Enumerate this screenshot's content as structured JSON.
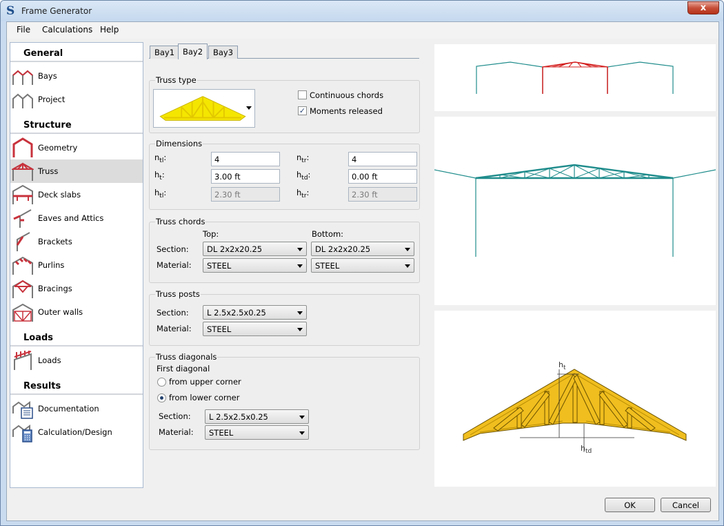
{
  "window": {
    "title": "Frame Generator",
    "app_icon_letter": "S",
    "close_symbol": "x"
  },
  "menu": {
    "file": "File",
    "calculations": "Calculations",
    "help": "Help"
  },
  "nav": {
    "general": "General",
    "bays": "Bays",
    "project": "Project",
    "structure": "Structure",
    "geometry": "Geometry",
    "truss": "Truss",
    "deck_slabs": "Deck slabs",
    "eaves": "Eaves and Attics",
    "brackets": "Brackets",
    "purlins": "Purlins",
    "bracings": "Bracings",
    "outer_walls": "Outer walls",
    "loads_section": "Loads",
    "loads": "Loads",
    "results": "Results",
    "documentation": "Documentation",
    "calculation": "Calculation/Design",
    "selected": "Truss"
  },
  "tabs": {
    "bay1": "Bay1",
    "bay2": "Bay2",
    "bay3": "Bay3",
    "active": "Bay2"
  },
  "truss_type": {
    "title": "Truss type",
    "continuous_chords": "Continuous chords",
    "continuous_checked": false,
    "moments_released": "Moments released",
    "moments_checked": true
  },
  "dimensions": {
    "title": "Dimensions",
    "ntl_main": "n",
    "ntl_sub": "tl",
    "ntl_value": "4",
    "ntr_main": "n",
    "ntr_sub": "tr",
    "ntr_value": "4",
    "ht_main": "h",
    "ht_sub": "t",
    "ht_value": "3.00 ft",
    "htd_main": "h",
    "htd_sub": "td",
    "htd_value": "0.00 ft",
    "htl_main": "h",
    "htl_sub": "tl",
    "htl_value": "2.30 ft",
    "htr_main": "h",
    "htr_sub": "tr",
    "htr_value": "2.30 ft",
    "colon": ":"
  },
  "chords": {
    "title": "Truss chords",
    "top": "Top:",
    "bottom": "Bottom:",
    "section_label": "Section:",
    "material_label": "Material:",
    "top_section": "DL 2x2x20.25",
    "bottom_section": "DL 2x2x20.25",
    "top_material": "STEEL",
    "bottom_material": "STEEL"
  },
  "posts": {
    "title": "Truss posts",
    "section_label": "Section:",
    "material_label": "Material:",
    "section": "L 2.5x2.5x0.25",
    "material": "STEEL"
  },
  "diagonals": {
    "title": "Truss diagonals",
    "first_diagonal": "First diagonal",
    "upper": "from upper corner",
    "lower": "from lower corner",
    "selected": "from lower corner",
    "section_label": "Section:",
    "material_label": "Material:",
    "section": "L 2.5x2.5x0.25",
    "material": "STEEL"
  },
  "preview": {
    "ht_main": "h",
    "ht_sub": "t",
    "htd_main": "h",
    "htd_sub": "td"
  },
  "buttons": {
    "ok": "OK",
    "cancel": "Cancel"
  },
  "colors": {
    "frame_teal": "#208c8c",
    "active_bay_red": "#d42020",
    "truss_yellow": "#f0be1e",
    "nav_icon_red": "#c8323c"
  }
}
